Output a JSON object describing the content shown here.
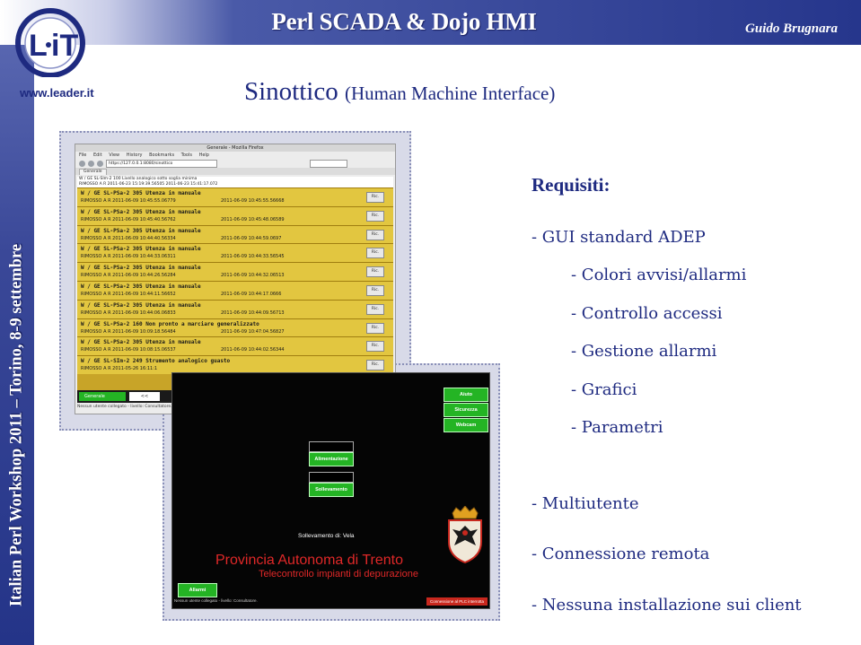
{
  "header": {
    "title": "Perl SCADA & Dojo HMI",
    "author": "Guido Brugnara",
    "logo_text": "L·IT",
    "url": "www.leader.it",
    "sidebar_text": "Italian Perl Workshop 2011 – Torino, 8-9 settembre"
  },
  "slide": {
    "subtitle_main": "Sinottico ",
    "subtitle_paren": "(Human Machine Interface)",
    "requirements_title": "Requisiti:",
    "bullets": [
      "- GUI standard ADEP",
      "- Colori avvisi/allarmi",
      "- Controllo accessi",
      "- Gestione allarmi",
      "- Grafici",
      "- Parametri",
      "- Multiutente",
      "- Connessione remota",
      "- Nessuna installazione sui client"
    ]
  },
  "firefox": {
    "title": "Generale - Mozilla Firefox",
    "menu": [
      "File",
      "Edit",
      "View",
      "History",
      "Bookmarks",
      "Tools",
      "Help"
    ],
    "url": "https://127.0.0.1:8080/sinottico",
    "tab": "Generale",
    "alarm_header_1": "W / GE SL-SIm-2 100 Livello analogico sotto soglia minima",
    "alarm_header_2": "RIMOSSO  A R  2011-06-23 15:19:39.56505    2011-06-23 15:41:17.072",
    "alarms": [
      {
        "l1": "W / GE SL-PSa-2 305 Utenza in manuale",
        "l2": "RIMOSSO   A R  2011-06-09 10:45:55.06779",
        "l2b": "2011-06-09 10:45:55.56668",
        "btn": "Ric."
      },
      {
        "l1": "W / GE SL-PSa-2 305 Utenza in manuale",
        "l2": "RIMOSSO   A R  2011-06-09 10:45:40.56762",
        "l2b": "2011-06-09 10:45:48.06589",
        "btn": "Ric."
      },
      {
        "l1": "W / GE SL-PSa-2 305 Utenza in manuale",
        "l2": "RIMOSSO   A R  2011-06-09 10:44:40.56334",
        "l2b": "2011-06-09 10:44:59.0697",
        "btn": "Ric."
      },
      {
        "l1": "W / GE SL-PSa-2 305 Utenza in manuale",
        "l2": "RIMOSSO   A R  2011-06-09 10:44:33.06311",
        "l2b": "2011-06-09 10:44:33.56545",
        "btn": "Ric."
      },
      {
        "l1": "W / GE SL-PSa-2 305 Utenza in manuale",
        "l2": "RIMOSSO   A R  2011-06-09 10:44:26.56284",
        "l2b": "2011-06-09 10:44:32.06513",
        "btn": "Ric."
      },
      {
        "l1": "W / GE SL-PSa-2 305 Utenza in manuale",
        "l2": "RIMOSSO   A R  2011-06-09 10:44:11.56652",
        "l2b": "2011-06-09 10:44:17.0666",
        "btn": "Ric."
      },
      {
        "l1": "W / GE SL-PSa-2 305 Utenza in manuale",
        "l2": "RIMOSSO   A R  2011-06-09 10:44:06.06833",
        "l2b": "2011-06-09 10:44:09.56713",
        "btn": "Ric."
      },
      {
        "l1": "W / GE SL-PSa-2 160 Non pronto a marciare generalizzato",
        "l2": "RIMOSSO   A R  2011-06-09 10:09:18.56484",
        "l2b": "2011-06-09 10:47:04.56827",
        "btn": "Ric."
      },
      {
        "l1": "W / GE SL-PSa-2 305 Utenza in manuale",
        "l2": "RIMOSSO   A R  2011-06-09 10:08:15.06537",
        "l2b": "2011-06-09 10:44:02.56344",
        "btn": "Ric."
      },
      {
        "l1": "W / GE SL-SIm-2 249 Strumento analogico guasto",
        "l2": "RIMOSSO   A R  2011-05-26 16:11:1",
        "l2b": "",
        "btn": "Ric."
      }
    ],
    "bottom_buttons": [
      "Generale",
      "<<"
    ],
    "status": "Nessun utente collegato - livello: Consultatore."
  },
  "hmi": {
    "buttons_right": [
      "Aiuto",
      "Sicurezza",
      "Webcam"
    ],
    "buttons_center": [
      "Alimentazione",
      "Sollevamento"
    ],
    "location": "Sollevamento di: Vela",
    "org": "Provincia Autonoma di Trento",
    "org_sub": "Telecontrollo impianti di depurazione",
    "alarms_button": "Allarmi",
    "status": "Nessun utente collegato - livello: Consultatore.",
    "plc_status": "Connessione al PLC interrotta"
  }
}
